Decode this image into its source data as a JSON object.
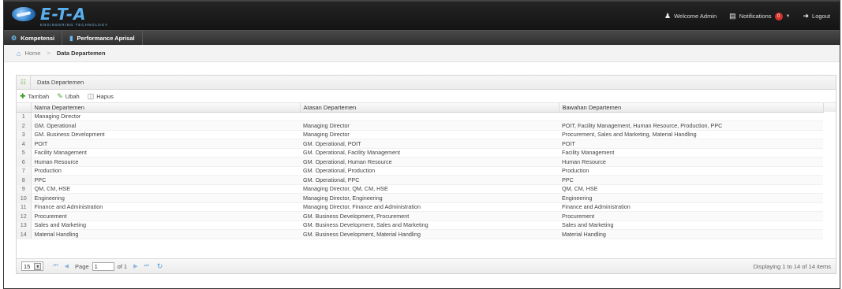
{
  "header": {
    "logo_text": "E-T-A",
    "logo_sub": "ENGINEERING TECHNOLOGY",
    "welcome": "Welcome Admin",
    "notifications_label": "Notifications",
    "notifications_count": "0",
    "logout": "Logout"
  },
  "menu": [
    {
      "label": "Kompetensi"
    },
    {
      "label": "Performance Aprisal"
    }
  ],
  "breadcrumb": {
    "home": "Home",
    "separator": ">",
    "current": "Data Departemen"
  },
  "panel": {
    "title": "Data Departemen"
  },
  "toolbar": {
    "add": "Tambah",
    "edit": "Ubah",
    "delete": "Hapus"
  },
  "table": {
    "columns": [
      "Nama Departemen",
      "Atasan Departemen",
      "Bawahan Departemen"
    ],
    "rows": [
      {
        "no": "1",
        "nama": "Managing Director",
        "atasan": "",
        "bawahan": ""
      },
      {
        "no": "2",
        "nama": "GM. Operational",
        "atasan": "Managing Director",
        "bawahan": "POIT, Facility Management, Human Resource, Production, PPC"
      },
      {
        "no": "3",
        "nama": "GM. Business Development",
        "atasan": "Managing Director",
        "bawahan": "Procurement, Sales and Marketing, Material Handling"
      },
      {
        "no": "4",
        "nama": "POIT",
        "atasan": "GM. Operational, POIT",
        "bawahan": "POIT"
      },
      {
        "no": "5",
        "nama": "Facility Management",
        "atasan": "GM. Operational, Facility Management",
        "bawahan": "Facility Management"
      },
      {
        "no": "6",
        "nama": "Human Resource",
        "atasan": "GM. Operational, Human Resource",
        "bawahan": "Human Resource"
      },
      {
        "no": "7",
        "nama": "Production",
        "atasan": "GM. Operational, Production",
        "bawahan": "Production"
      },
      {
        "no": "8",
        "nama": "PPC",
        "atasan": "GM. Operational, PPC",
        "bawahan": "PPC"
      },
      {
        "no": "9",
        "nama": "QM, CM, HSE",
        "atasan": "Managing Director, QM, CM, HSE",
        "bawahan": "QM, CM, HSE"
      },
      {
        "no": "10",
        "nama": "Engineering",
        "atasan": "Managing Director, Engineering",
        "bawahan": "Engineering"
      },
      {
        "no": "11",
        "nama": "Finance and Administration",
        "atasan": "Managing Director, Finance and Administration",
        "bawahan": "Finance and Administration"
      },
      {
        "no": "12",
        "nama": "Procurement",
        "atasan": "GM. Business Development, Procurement",
        "bawahan": "Procurement"
      },
      {
        "no": "13",
        "nama": "Sales and Marketing",
        "atasan": "GM. Business Development, Sales and Marketing",
        "bawahan": "Sales and Marketing"
      },
      {
        "no": "14",
        "nama": "Material Handling",
        "atasan": "GM. Business Development, Material Handling",
        "bawahan": "Material Handling"
      }
    ]
  },
  "pager": {
    "page_size": "15",
    "page_label": "Page",
    "page_value": "1",
    "of_label": "of 1",
    "info": "Displaying 1 to 14 of 14 items"
  }
}
